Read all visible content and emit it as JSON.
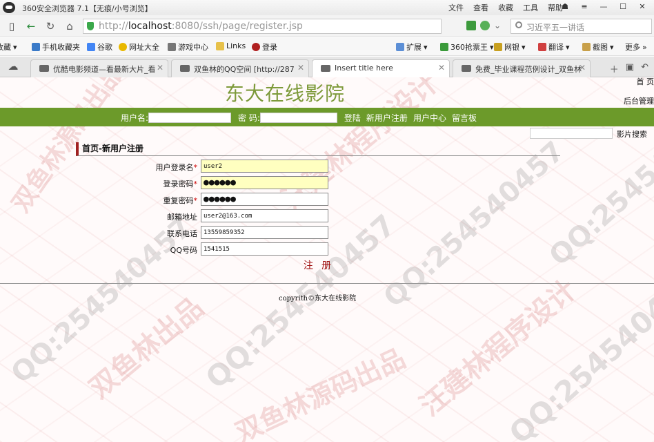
{
  "window": {
    "title": "360安全浏览器 7.1【无痕/小号浏览】",
    "menu": [
      "文件",
      "查看",
      "收藏",
      "工具",
      "帮助"
    ]
  },
  "addressbar": {
    "url_prefix": "http://",
    "url_host": "localhost",
    "url_rest": ":8080/ssh/page/register.jsp",
    "search_placeholder": "习近平五一讲话"
  },
  "bookmarks": [
    "收藏",
    "手机收藏夹",
    "谷歌",
    "网址大全",
    "游戏中心",
    "Links",
    "登录"
  ],
  "bookmarks_right": [
    "扩展",
    "360抢票王",
    "网银",
    "翻译",
    "截图",
    "更多"
  ],
  "tabs": [
    {
      "label": "优酷电影频道—看最新大片_看"
    },
    {
      "label": "双鱼林的QQ空间 [http://287"
    },
    {
      "label": "Insert title here"
    },
    {
      "label": "免费_毕业课程范例设计_双鱼林"
    }
  ],
  "page": {
    "site_title": "东大在线影院",
    "home_link": "首 页",
    "admin_link": "后台管理",
    "login": {
      "user_label": "用户名:",
      "pass_label": "密 码:",
      "login_link": "登陆",
      "register_link": "新用户注册",
      "center_link": "用户中心",
      "board_link": "留言板"
    },
    "movie_search_label": "影片搜索",
    "breadcrumb": "首页-新用户注册",
    "form": [
      {
        "label": "用户登录名",
        "required": true,
        "value": "user2",
        "highlight": true,
        "password": false
      },
      {
        "label": "登录密码",
        "required": true,
        "value": "●●●●●●",
        "highlight": true,
        "password": true
      },
      {
        "label": "重复密码",
        "required": true,
        "value": "●●●●●●",
        "highlight": false,
        "password": true
      },
      {
        "label": "邮箱地址",
        "required": false,
        "value": "user2@163.com",
        "highlight": false,
        "password": false
      },
      {
        "label": "联系电话",
        "required": false,
        "value": "13559859352",
        "highlight": false,
        "password": false
      },
      {
        "label": "QQ号码",
        "required": false,
        "value": "1541515",
        "highlight": false,
        "password": false
      }
    ],
    "submit_label": "注册",
    "copyright": "copyrith©东大在线影院"
  },
  "watermarks": [
    "QQ:254540457",
    "双鱼林源码出品",
    "汪建林程序设计",
    "双鱼林出品"
  ],
  "colors": {
    "green_bar": "#6c9a2a",
    "site_title": "#7d9a3a",
    "breadcrumb_accent": "#a02020",
    "submit": "#a01010"
  }
}
